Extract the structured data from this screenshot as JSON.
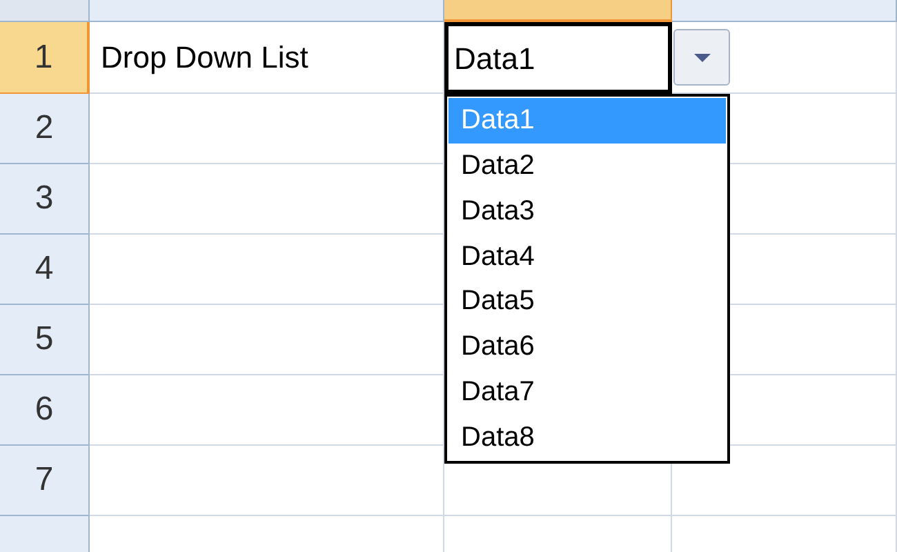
{
  "column_headers": [
    {
      "selected": false
    },
    {
      "selected": true
    },
    {
      "selected": false
    }
  ],
  "rows": [
    {
      "label": "1",
      "selected": true,
      "cells": [
        {
          "text": "Drop Down List",
          "active": false
        },
        {
          "text": "Data1",
          "active": true
        }
      ]
    },
    {
      "label": "2",
      "selected": false
    },
    {
      "label": "3",
      "selected": false
    },
    {
      "label": "4",
      "selected": false
    },
    {
      "label": "5",
      "selected": false
    },
    {
      "label": "6",
      "selected": false
    },
    {
      "label": "7",
      "selected": false
    },
    {
      "selected": false
    }
  ],
  "dropdown": {
    "options": [
      {
        "label": "Data1",
        "selected": true
      },
      {
        "label": "Data2",
        "selected": false
      },
      {
        "label": "Data3",
        "selected": false
      },
      {
        "label": "Data4",
        "selected": false
      },
      {
        "label": "Data5",
        "selected": false
      },
      {
        "label": "Data6",
        "selected": false
      },
      {
        "label": "Data7",
        "selected": false
      },
      {
        "label": "Data8",
        "selected": false
      }
    ]
  }
}
